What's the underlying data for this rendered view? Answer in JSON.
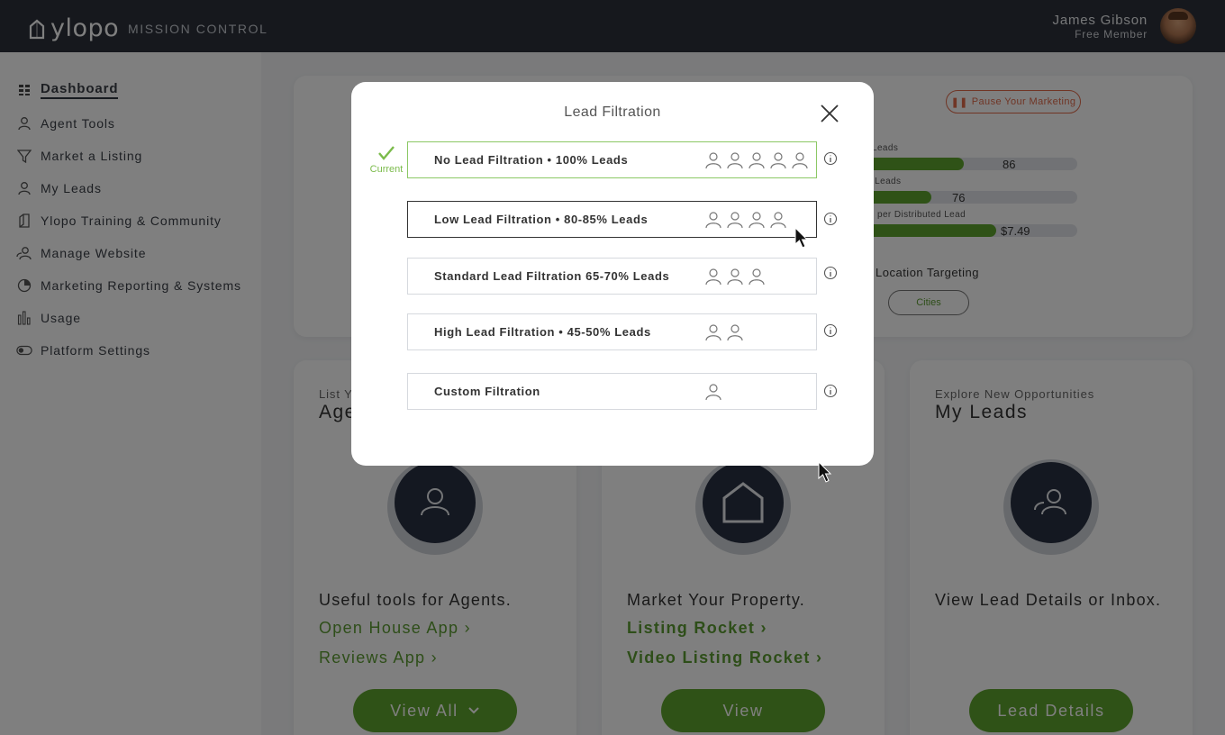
{
  "app": {
    "brand": "ylopo",
    "section": "MISSION CONTROL",
    "user_name": "James Gibson",
    "user_status": "Free Member"
  },
  "sidebar": {
    "items": [
      {
        "label": "Dashboard",
        "icon": "grid-icon",
        "active": true
      },
      {
        "label": "Agent Tools",
        "icon": "person-icon"
      },
      {
        "label": "Market a Listing",
        "icon": "funnel-icon"
      },
      {
        "label": "My Leads",
        "icon": "person-icon"
      },
      {
        "label": "Ylopo Training & Community",
        "icon": "book-icon"
      },
      {
        "label": "Manage Website",
        "icon": "users-icon"
      },
      {
        "label": "Marketing Reporting & Systems",
        "icon": "pie-chart-icon"
      },
      {
        "label": "Usage",
        "icon": "bar-chart-icon"
      },
      {
        "label": "Platform Settings",
        "icon": "toggle-icon"
      }
    ]
  },
  "summary": {
    "pause_label": "Pause Your Marketing",
    "metrics": [
      {
        "label": "Leads",
        "value": "86",
        "fill": 0.86
      },
      {
        "label": "d Leads",
        "value": "76",
        "fill": 0.76
      },
      {
        "label": "per Distributed Lead",
        "value": "$7.49",
        "fill": 1.0
      }
    ],
    "location_title": "Location Targeting",
    "cities_label": "Cities"
  },
  "cards": [
    {
      "kicker": "List Y",
      "title": "Age",
      "description": "Useful tools for Agents.",
      "links": [
        "Open House App ›",
        "Reviews App ›"
      ],
      "button": "View All",
      "icon": "person-icon"
    },
    {
      "kicker": "",
      "title": "",
      "description": "Market Your Property.",
      "links": [
        "Listing Rocket ›",
        "Video Listing Rocket ›"
      ],
      "button": "View",
      "icon": "house-icon"
    },
    {
      "kicker": "Explore New Opportunities",
      "title": "My Leads",
      "description": "View Lead Details or Inbox.",
      "links": [],
      "button": "Lead Details",
      "icon": "users-icon"
    }
  ],
  "modal": {
    "title": "Lead Filtration",
    "current_label": "Current",
    "options": [
      {
        "label": "No Lead Filtration • 100% Leads",
        "people": 5,
        "state": "current"
      },
      {
        "label": "Low Lead Filtration • 80-85% Leads",
        "people": 4,
        "state": "hover"
      },
      {
        "label": "Standard Lead Filtration 65-70% Leads",
        "people": 3,
        "state": "default"
      },
      {
        "label": "High Lead Filtration • 45-50% Leads",
        "people": 2,
        "state": "default"
      },
      {
        "label": "Custom Filtration",
        "people": 1,
        "state": "default"
      }
    ]
  },
  "colors": {
    "accent_green": "#5fa52f",
    "current_green": "#8cc865",
    "topbar": "#2c313a",
    "pause_red": "#e06a4a"
  }
}
